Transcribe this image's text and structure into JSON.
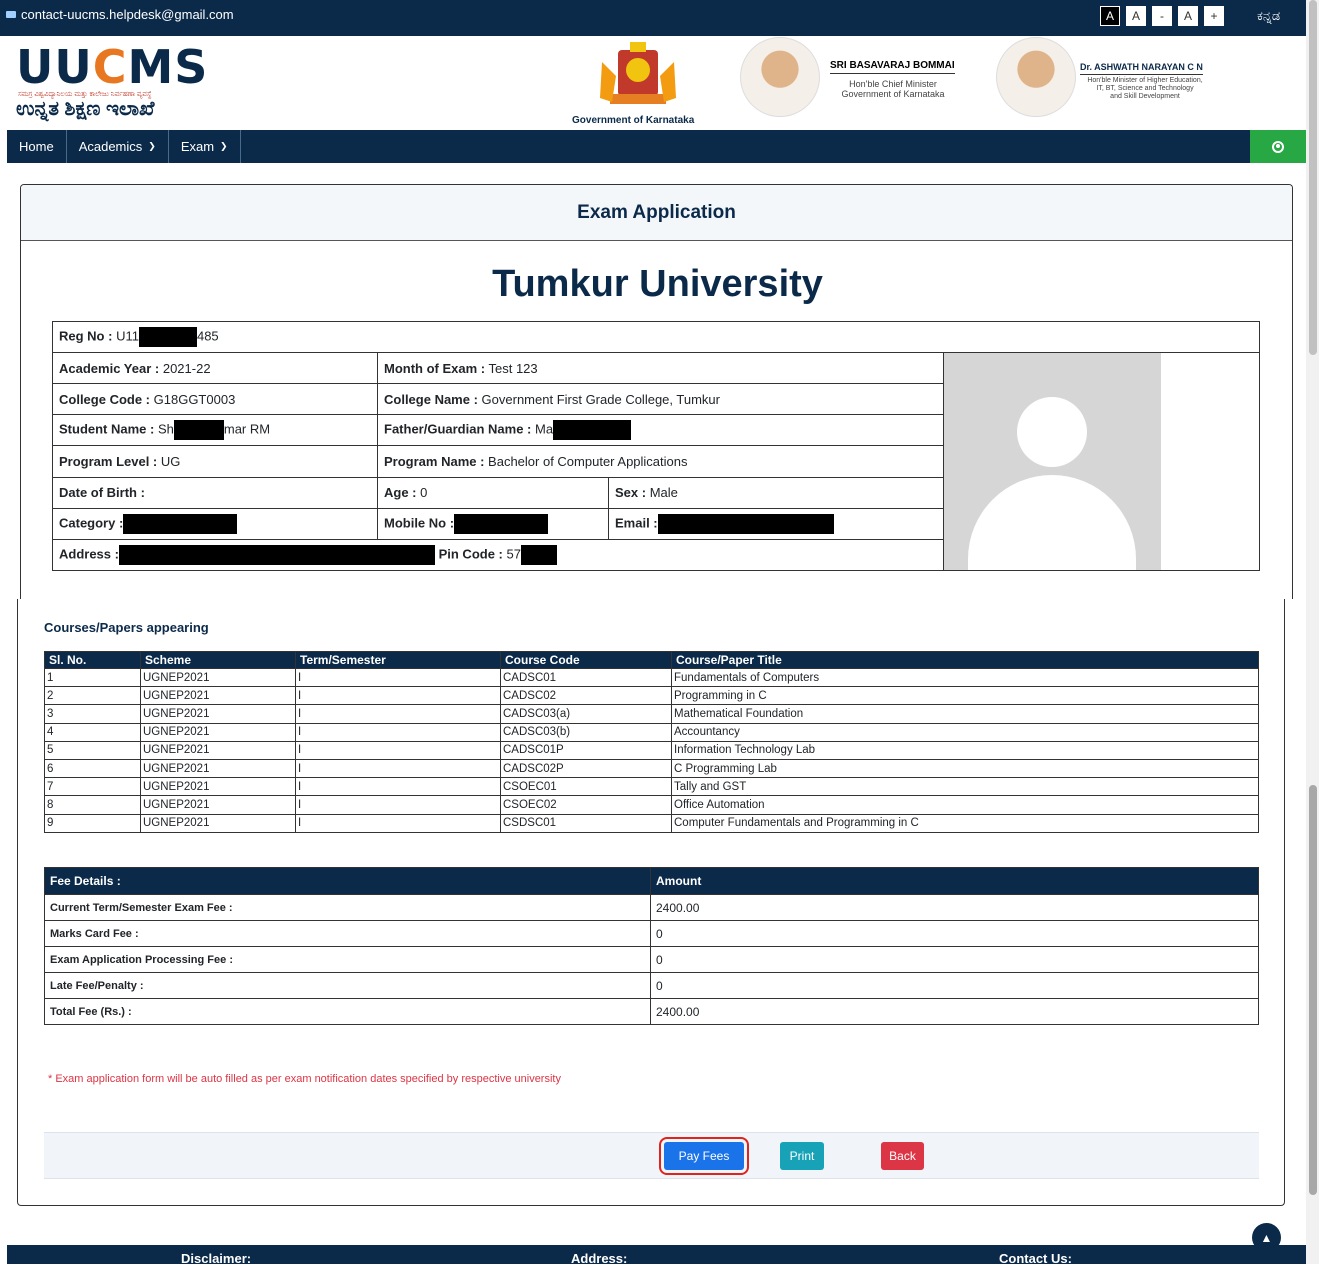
{
  "topbar": {
    "email": "contact-uucms.helpdesk@gmail.com",
    "font_controls": [
      "A",
      "A",
      "-",
      "A",
      "+"
    ],
    "language": "ಕನ್ನಡ"
  },
  "header": {
    "logo": "UUCMS",
    "logo_tagline": "ಸಮಗ್ರ ವಿಶ್ವವಿದ್ಯಾನಿಲಯ ಮತ್ತು ಕಾಲೇಜು ನಿರ್ವಹಣಾ ವ್ಯವಸ್ಥೆ",
    "logo_kannada": "ಉನ್ನತ ಶಿಕ್ಷಣ ಇಲಾಖೆ",
    "emblem_caption": "Government of Karnataka",
    "cm_name": "SRI BASAVARAJ BOMMAI",
    "cm_role_1": "Hon'ble Chief Minister",
    "cm_role_2": "Government of Karnataka",
    "minister_name": "Dr. ASHWATH NARAYAN C N",
    "minister_role_1": "Hon'ble Minister of Higher Education,",
    "minister_role_2": "IT, BT, Science and Technology",
    "minister_role_3": "and Skill Development"
  },
  "nav": {
    "home": "Home",
    "academics": "Academics",
    "exam": "Exam"
  },
  "page": {
    "heading": "Exam Application",
    "university": "Tumkur University"
  },
  "student": {
    "reg_label": "Reg No :",
    "reg_prefix": "U11",
    "reg_suffix": "485",
    "year_label": "Academic Year :",
    "year": "2021-22",
    "month_label": "Month of Exam :",
    "month": "Test 123",
    "college_code_label": "College Code :",
    "college_code": "G18GGT0003",
    "college_name_label": "College Name :",
    "college_name": "Government First Grade College, Tumkur",
    "student_name_label": "Student Name :",
    "student_name_prefix": "Sh",
    "student_name_suffix": "mar RM",
    "father_label": "Father/Guardian Name :",
    "father_prefix": "Ma",
    "level_label": "Program Level :",
    "level": "UG",
    "program_label": "Program Name :",
    "program": "Bachelor of Computer Applications",
    "dob_label": "Date of Birth :",
    "age_label": "Age :",
    "age": "0",
    "sex_label": "Sex :",
    "sex": "Male",
    "category_label": "Category :",
    "mobile_label": "Mobile No :",
    "email_label": "Email :",
    "address_label": "Address :",
    "pin_label": "Pin Code :",
    "pin_prefix": "57"
  },
  "courses": {
    "title": "Courses/Papers appearing",
    "headers": [
      "Sl. No.",
      "Scheme",
      "Term/Semester",
      "Course Code",
      "Course/Paper Title"
    ],
    "rows": [
      [
        "1",
        "UGNEP2021",
        "I",
        "CADSC01",
        "Fundamentals of Computers"
      ],
      [
        "2",
        "UGNEP2021",
        "I",
        "CADSC02",
        "Programming in C"
      ],
      [
        "3",
        "UGNEP2021",
        "I",
        "CADSC03(a)",
        "Mathematical Foundation"
      ],
      [
        "4",
        "UGNEP2021",
        "I",
        "CADSC03(b)",
        "Accountancy"
      ],
      [
        "5",
        "UGNEP2021",
        "I",
        "CADSC01P",
        "Information Technology Lab"
      ],
      [
        "6",
        "UGNEP2021",
        "I",
        "CADSC02P",
        "C Programming Lab"
      ],
      [
        "7",
        "UGNEP2021",
        "I",
        "CSOEC01",
        "Tally and GST"
      ],
      [
        "8",
        "UGNEP2021",
        "I",
        "CSOEC02",
        "Office Automation"
      ],
      [
        "9",
        "UGNEP2021",
        "I",
        "CSDSC01",
        "Computer Fundamentals and Programming in C"
      ]
    ]
  },
  "fees": {
    "header_label": "Fee Details :",
    "header_amount": "Amount",
    "rows": [
      [
        "Current Term/Semester Exam Fee :",
        "2400.00"
      ],
      [
        "Marks Card Fee :",
        "0"
      ],
      [
        "Exam Application Processing Fee :",
        "0"
      ],
      [
        "Late Fee/Penalty :",
        "0"
      ],
      [
        "Total Fee (Rs.) :",
        "2400.00"
      ]
    ]
  },
  "note": "* Exam application form will be auto filled as per exam notification dates specified by respective university",
  "actions": {
    "pay": "Pay Fees",
    "print": "Print",
    "back": "Back"
  },
  "footer": {
    "disclaimer": "Disclaimer:",
    "address": "Address:",
    "contact": "Contact Us:"
  }
}
